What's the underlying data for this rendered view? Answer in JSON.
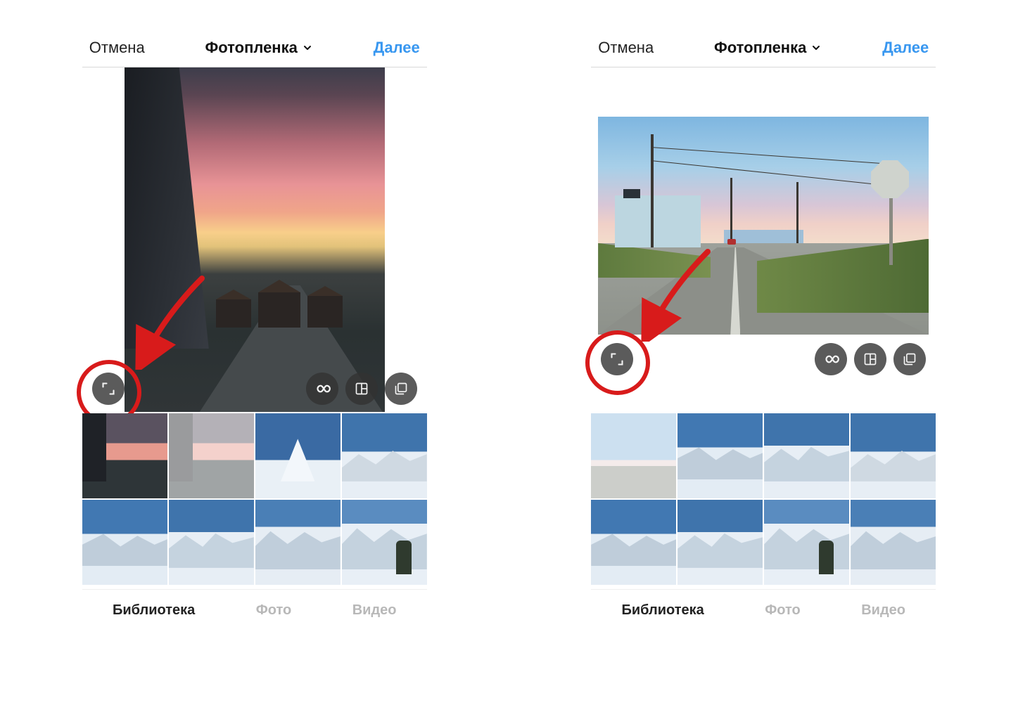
{
  "screens": [
    {
      "topbar": {
        "cancel": "Отмена",
        "title": "Фотопленка",
        "next": "Далее"
      },
      "preview": {
        "aspect": "portrait",
        "buttons": {
          "expand": "expand-icon",
          "boomerang": "infinity-icon",
          "layout": "layout-icon",
          "multi": "multi-select-icon"
        }
      },
      "annotation": {
        "target": "expand-button",
        "style": "red-circle-arrow"
      },
      "grid": {
        "selected_index": 1,
        "items": [
          "sunset-1",
          "sunset-2",
          "mountain-peak",
          "snow-1",
          "snow-2",
          "snow-3",
          "snow-4",
          "snow-person"
        ]
      },
      "tabs": {
        "items": [
          "Библиотека",
          "Фото",
          "Видео"
        ],
        "active_index": 0
      }
    },
    {
      "topbar": {
        "cancel": "Отмена",
        "title": "Фотопленка",
        "next": "Далее"
      },
      "preview": {
        "aspect": "landscape",
        "buttons": {
          "expand": "expand-icon",
          "boomerang": "infinity-icon",
          "layout": "layout-icon",
          "multi": "multi-select-icon"
        }
      },
      "annotation": {
        "target": "expand-button",
        "style": "red-circle-arrow"
      },
      "grid": {
        "selected_index": 0,
        "items": [
          "road-1",
          "snow-2",
          "snow-3",
          "snow-1",
          "snow-2",
          "snow-3",
          "snow-person",
          "snow-4"
        ]
      },
      "tabs": {
        "items": [
          "Библиотека",
          "Фото",
          "Видео"
        ],
        "active_index": 0
      }
    }
  ],
  "colors": {
    "accent": "#3897f0",
    "annotation": "#d81b1b",
    "button_bg": "rgba(50,50,50,0.8)"
  }
}
